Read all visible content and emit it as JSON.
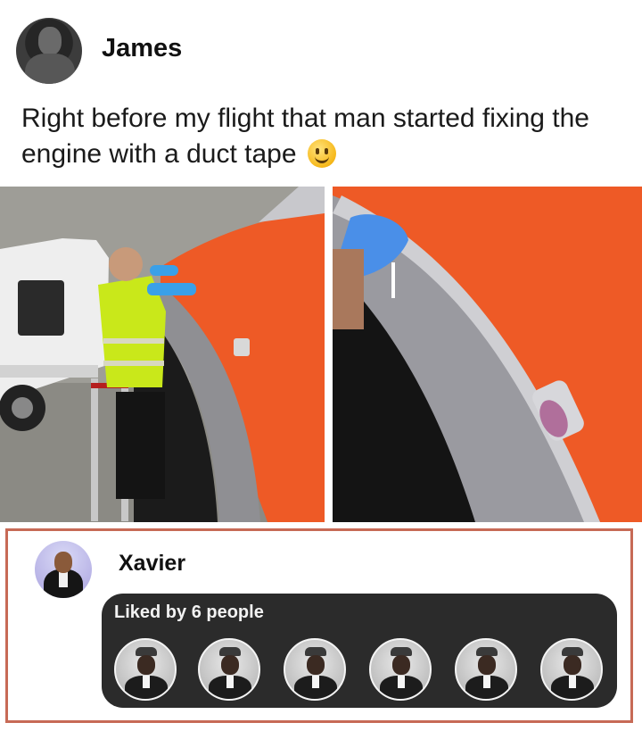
{
  "post": {
    "author": "James",
    "text": "Right before my flight that man started fixing the engine with a duct tape",
    "emoji": "slightly-smiling-face"
  },
  "comment": {
    "author": "Xavier",
    "likes_label": "Liked by 6 people",
    "liker_count": 6
  },
  "colors": {
    "engine_orange": "#ee5a26",
    "comment_border": "#c76a56",
    "likes_panel_bg": "#2b2b2b"
  }
}
